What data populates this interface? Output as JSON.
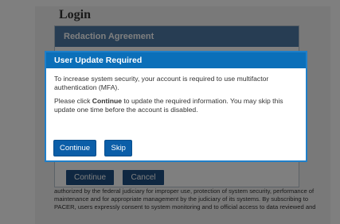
{
  "background": {
    "logo_text": "Login",
    "redaction_dialog": {
      "title": "Redaction Agreement",
      "continue_label": "Continue",
      "cancel_label": "Cancel"
    },
    "login_text": "authorized by the federal judiciary for improper use, protection of system security, performance of maintenance and for appropriate management by the judiciary of its systems. By subscribing to PACER, users expressly consent to system monitoring and to official access to data reviewed and"
  },
  "modal": {
    "title": "User Update Required",
    "paragraph1": "To increase system security, your account is required to use multifactor authentication (MFA).",
    "paragraph2_before": "Please click ",
    "paragraph2_bold": "Continue",
    "paragraph2_after": " to update the required information. You may skip this update one time before the account is disabled.",
    "continue_label": "Continue",
    "skip_label": "Skip"
  },
  "colors": {
    "modal_header": "#0b6fb9",
    "button": "#0b5ea8",
    "redaction_header": "#4f7aa6",
    "overlay": "rgba(0,0,0,0.5)"
  }
}
